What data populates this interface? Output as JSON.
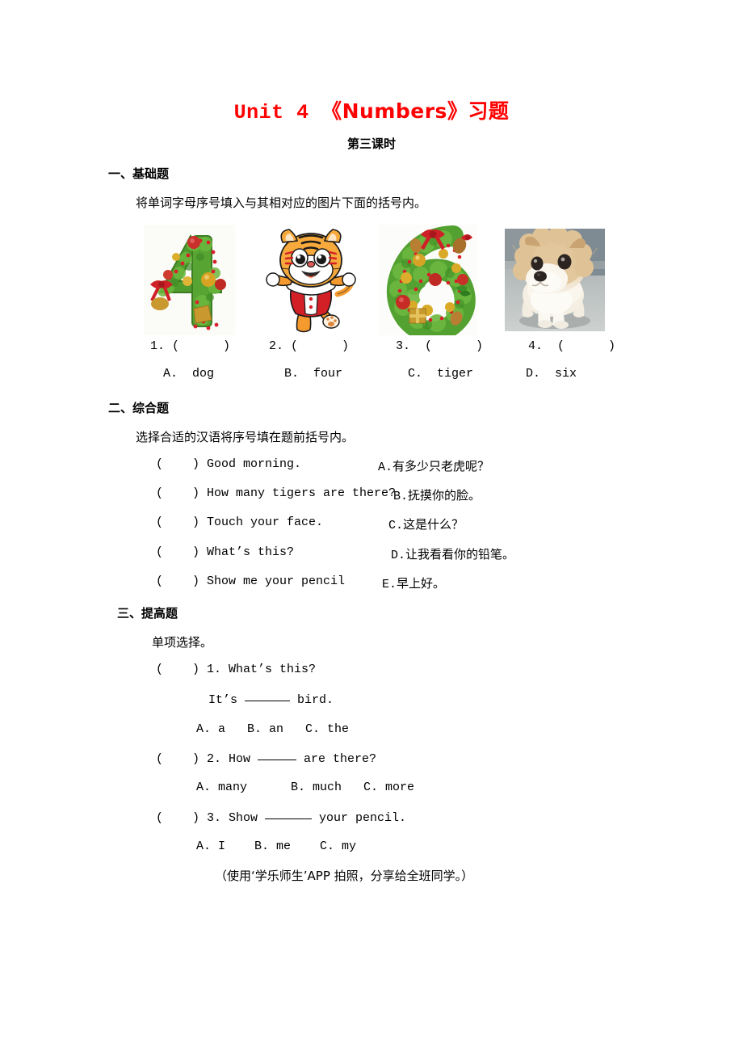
{
  "title": {
    "latin_part": "Unit 4 ",
    "cjk_part": "《Numbers》习题",
    "subtitle": "第三课时",
    "color": "#ff0000"
  },
  "section1": {
    "heading": "一、基础题",
    "instruction": "将单词字母序号填入与其相对应的图片下面的括号内。",
    "pictures": [
      {
        "alt": "christmas-number-four",
        "label": "4"
      },
      {
        "alt": "cartoon-tiger-mascot",
        "label": "tiger"
      },
      {
        "alt": "christmas-number-six",
        "label": "6"
      },
      {
        "alt": "pomeranian-puppy-photo",
        "label": "dog"
      }
    ],
    "number_brackets": [
      "1. (      )",
      "2. (      )",
      "3.  (      )",
      "4.  (      )"
    ],
    "options": [
      "A.  dog",
      "B.  four",
      "C.  tiger",
      "D.  six"
    ]
  },
  "section2": {
    "heading": "二、综合题",
    "instruction": "选择合适的汉语将序号填在题前括号内。",
    "left_items": [
      "(    ) Good morning.",
      "(    ) How many tigers are there?",
      "(    ) Touch your face.",
      "(    ) What’s this?",
      "(    ) Show me your pencil"
    ],
    "right_items": [
      {
        "letter": "A.",
        "text": "有多少只老虎呢？"
      },
      {
        "letter": "B.",
        "text": "抚摸你的脸。"
      },
      {
        "letter": "C.",
        "text": "这是什么？"
      },
      {
        "letter": "D.",
        "text": "让我看看你的铅笔。"
      },
      {
        "letter": "E.",
        "text": "早上好。"
      }
    ]
  },
  "section3": {
    "heading": "三、提高题",
    "instruction": "单项选择。",
    "questions": [
      {
        "stem": "(    ) 1. What’s this?",
        "continuation_pre": "It’s ",
        "continuation_post": " bird.",
        "choices": "A. a   B. an   C. the"
      },
      {
        "stem_pre": "(    ) 2. How ",
        "stem_post": " are there?",
        "choices": "A. many      B. much   C. more"
      },
      {
        "stem_pre": "(    ) 3. Show ",
        "stem_post": " your pencil.",
        "choices": "A. I    B. me    C. my"
      }
    ],
    "footer_note": "（使用‘学乐师生’APP 拍照，分享给全班同学。）"
  }
}
